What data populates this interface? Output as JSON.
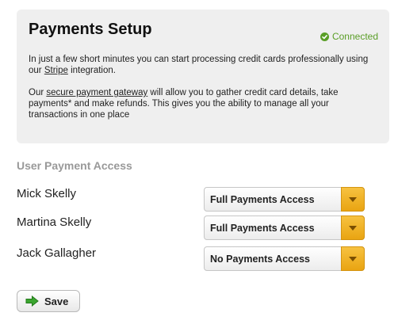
{
  "setup": {
    "title": "Payments Setup",
    "status": "Connected",
    "status_icon": "check-circle-icon",
    "status_color": "#5a9e27",
    "para1_pre": "In just a few short minutes you can start processing credit cards professionally using our ",
    "para1_link": "Stripe",
    "para1_post": " integration.",
    "para2_pre": "Our ",
    "para2_link": "secure payment gateway",
    "para2_post": " will allow you to gather credit card details, take payments* and make refunds. This gives you the ability to manage all your transactions in one place"
  },
  "access": {
    "heading": "User Payment Access",
    "users": [
      {
        "name": "Mick Skelly",
        "selected": "Full Payments Access"
      },
      {
        "name": "Martina Skelly",
        "selected": "Full Payments Access"
      },
      {
        "name": "Jack Gallagher",
        "selected": "No Payments Access"
      }
    ],
    "accent_color": "#f0b32a"
  },
  "actions": {
    "save_label": "Save",
    "save_icon": "arrow-right-icon"
  }
}
